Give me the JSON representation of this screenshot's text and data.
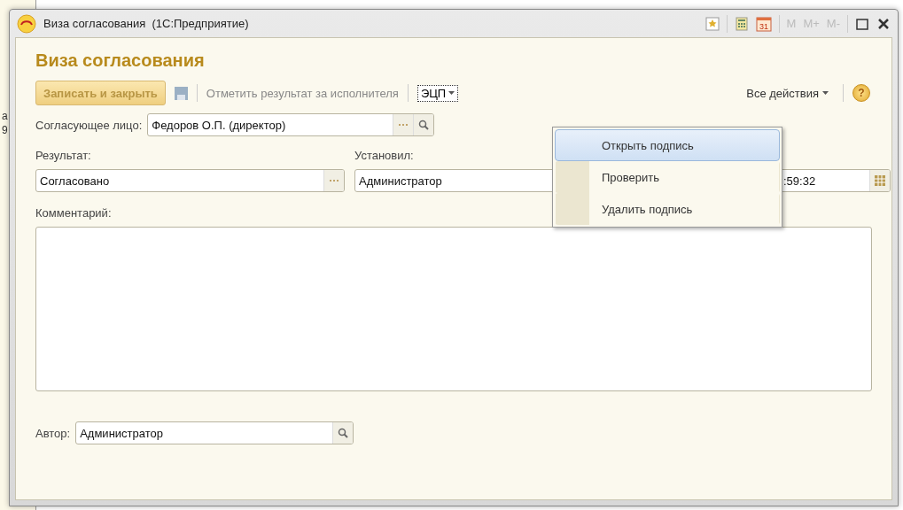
{
  "background_window": {
    "fragments": [
      "а",
      "9"
    ]
  },
  "window": {
    "title": "Виза согласования  (1С:Предприятие)",
    "memory_buttons": [
      "M",
      "M+",
      "M-"
    ],
    "calendar_day": "31"
  },
  "form": {
    "heading": "Виза согласования"
  },
  "toolbar": {
    "save_close": "Записать и закрыть",
    "mark_result": "Отметить результат за исполнителя",
    "signature_menu": "ЭЦП",
    "all_actions": "Все действия",
    "help": "?"
  },
  "approver": {
    "label": "Согласующее лицо:",
    "value": "Федоров О.П. (директор)"
  },
  "result": {
    "label": "Результат:",
    "value": "Согласовано"
  },
  "set_by": {
    "label": "Установил:",
    "value": "Администратор"
  },
  "date": {
    "value": ":59:32"
  },
  "comment": {
    "label": "Комментарий:"
  },
  "author": {
    "label": "Автор:",
    "value": "Администратор"
  },
  "dropdown": {
    "items": [
      {
        "label": "Открыть подпись",
        "selected": true
      },
      {
        "label": "Проверить",
        "selected": false
      },
      {
        "label": "Удалить подпись",
        "selected": false
      }
    ]
  }
}
